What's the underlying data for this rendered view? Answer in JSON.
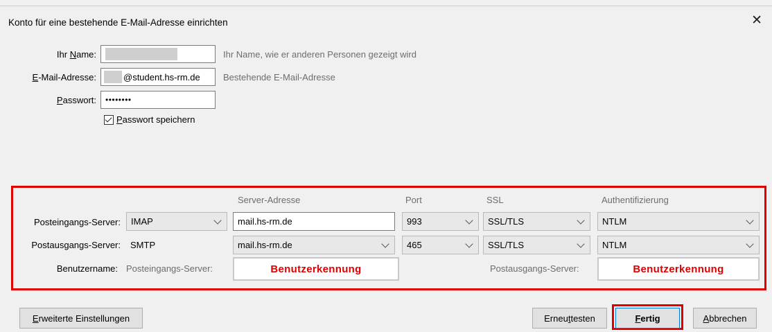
{
  "dialog": {
    "title": "Konto für eine bestehende E-Mail-Adresse einrichten"
  },
  "form": {
    "name_label_pre": "Ihr ",
    "name_label_u": "N",
    "name_label_post": "ame:",
    "name_hint": "Ihr Name, wie er anderen Personen gezeigt wird",
    "email_label_u": "E",
    "email_label_post": "-Mail-Adresse:",
    "email_value_suffix": "@student.hs-rm.de",
    "email_hint": "Bestehende E-Mail-Adresse",
    "password_label_u": "P",
    "password_label_post": "asswort:",
    "password_value": "••••••••",
    "save_password_u": "P",
    "save_password_post": "asswort speichern"
  },
  "server_table": {
    "headers": {
      "address": "Server-Adresse",
      "port": "Port",
      "ssl": "SSL",
      "auth": "Authentifizierung"
    },
    "incoming": {
      "label": "Posteingangs-Server:",
      "protocol": "IMAP",
      "address": "mail.hs-rm.de",
      "port": "993",
      "ssl": "SSL/TLS",
      "auth": "NTLM"
    },
    "outgoing": {
      "label": "Postausgangs-Server:",
      "protocol": "SMTP",
      "address": "mail.hs-rm.de",
      "port": "465",
      "ssl": "SSL/TLS",
      "auth": "NTLM"
    },
    "username": {
      "label": "Benutzername:",
      "incoming_label": "Posteingangs-Server:",
      "incoming_value": "Benutzerkennung",
      "outgoing_label": "Postausgangs-Server:",
      "outgoing_value": "Benutzerkennung"
    }
  },
  "buttons": {
    "advanced_u": "E",
    "advanced_post": "rweiterte Einstellungen",
    "retest_pre": "Erneu",
    "retest_u": "t",
    "retest_post": " testen",
    "done_u": "F",
    "done_post": "ertig",
    "cancel_u": "A",
    "cancel_post": "bbrechen"
  },
  "colors": {
    "highlight": "#e00000"
  }
}
